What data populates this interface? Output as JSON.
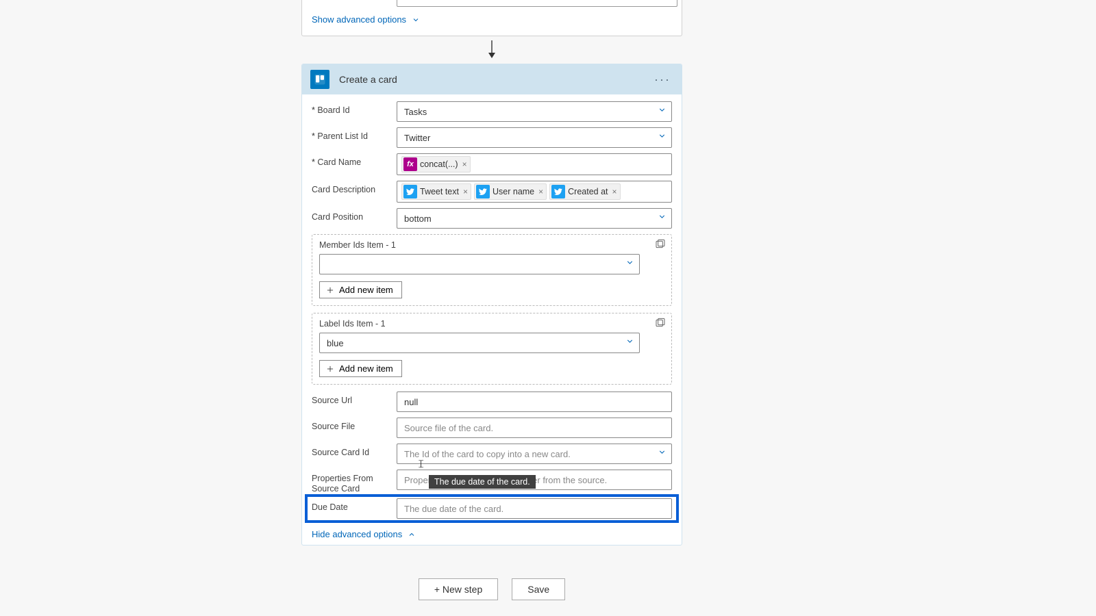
{
  "top": {
    "show_advanced": "Show advanced options"
  },
  "action": {
    "title": "Create a card",
    "more": "···"
  },
  "fields": {
    "board_id": {
      "label": "Board Id",
      "value": "Tasks"
    },
    "parent_list": {
      "label": "Parent List Id",
      "value": "Twitter"
    },
    "card_name": {
      "label": "Card Name",
      "token": "concat(...)"
    },
    "card_desc": {
      "label": "Card Description",
      "tokens": [
        "Tweet text",
        "User name",
        "Created at"
      ]
    },
    "card_pos": {
      "label": "Card Position",
      "value": "bottom"
    },
    "member_ids": {
      "label": "Member Ids Item - 1",
      "add": "Add new item"
    },
    "label_ids": {
      "label": "Label Ids Item - 1",
      "value": "blue",
      "add": "Add new item"
    },
    "source_url": {
      "label": "Source Url",
      "value": "null"
    },
    "source_file": {
      "label": "Source File",
      "placeholder": "Source file of the card."
    },
    "source_card_id": {
      "label": "Source Card Id",
      "placeholder": "The Id of the card to copy into a new card."
    },
    "props_from_source": {
      "label": "Properties From Source Card",
      "placeholder": "Properties of the card to copy over from the source."
    },
    "due_date": {
      "label": "Due Date",
      "placeholder": "The due date of the card."
    }
  },
  "hide_advanced": "Hide advanced options",
  "tooltip": "The due date of the card.",
  "footer": {
    "new_step": "+ New step",
    "save": "Save"
  }
}
